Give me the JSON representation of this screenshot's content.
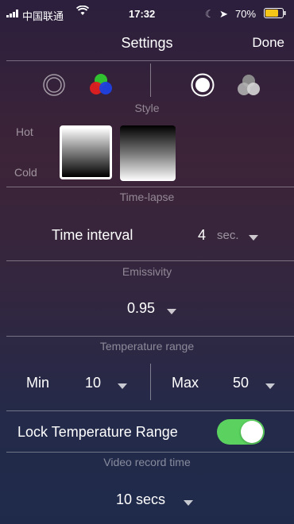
{
  "status_bar": {
    "carrier": "中国联通",
    "time": "17:32",
    "battery_percent": "70%"
  },
  "nav": {
    "title": "Settings",
    "done_label": "Done"
  },
  "sections": {
    "style": {
      "caption": "Style",
      "hot_label": "Hot",
      "cold_label": "Cold"
    },
    "timelapse": {
      "caption": "Time-lapse",
      "interval_label": "Time interval",
      "interval_value": "4",
      "interval_unit": "sec."
    },
    "emissivity": {
      "caption": "Emissivity",
      "value": "0.95"
    },
    "temperature_range": {
      "caption": "Temperature range",
      "min_label": "Min",
      "min_value": "10",
      "max_label": "Max",
      "max_value": "50"
    },
    "lock": {
      "label": "Lock Temperature Range",
      "toggle_on": true,
      "toggle_color": "#5bd25f"
    },
    "video": {
      "caption": "Video record time",
      "value": "10 secs"
    }
  }
}
